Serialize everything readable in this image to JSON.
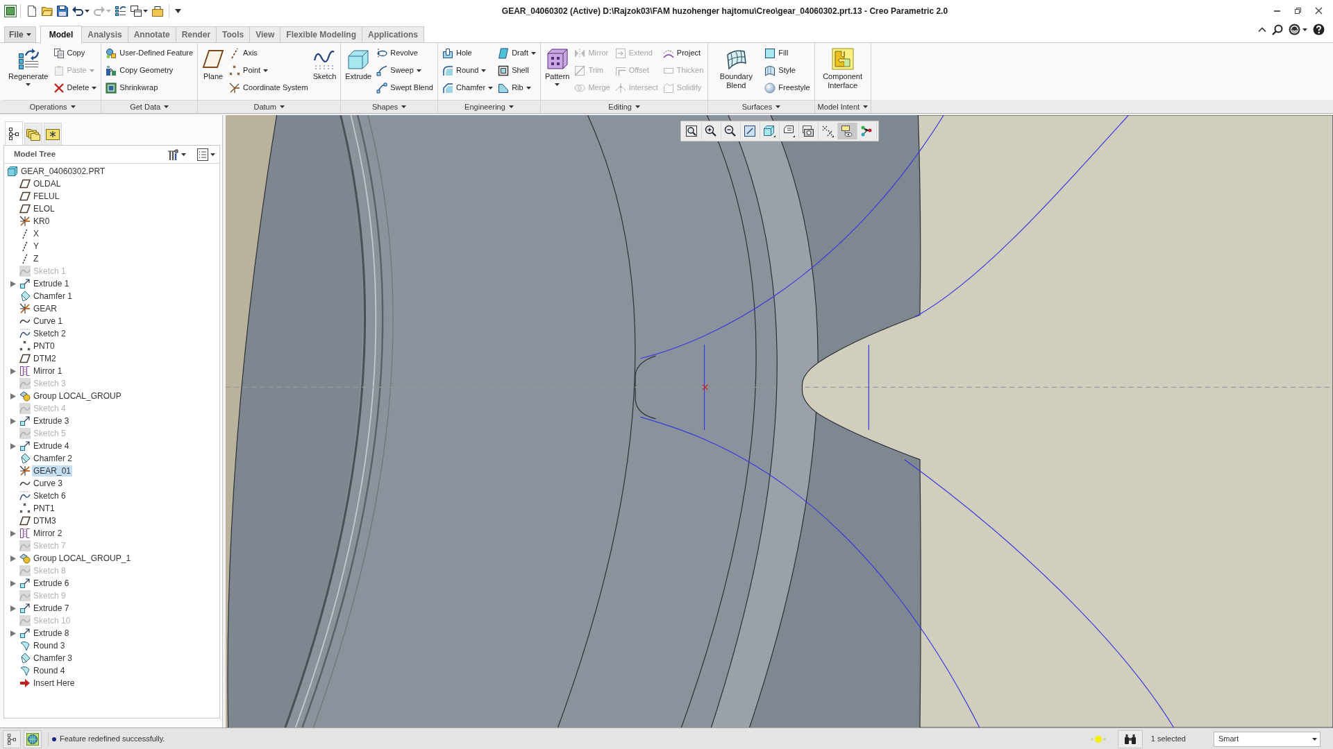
{
  "window": {
    "title": "GEAR_04060302 (Active) D:\\Rajzok03\\FAM huzohenger hajtomu\\Creo\\gear_04060302.prt.13 - Creo Parametric 2.0"
  },
  "quick_access_toolbar": [
    {
      "disabled": false,
      "dropdown": false
    },
    {
      "disabled": false,
      "dropdown": false
    },
    {
      "disabled": false,
      "dropdown": false
    },
    {
      "disabled": false,
      "dropdown": true
    },
    {
      "disabled": true,
      "dropdown": true
    },
    {
      "disabled": false,
      "dropdown": false
    },
    {
      "disabled": false,
      "dropdown": true
    },
    {
      "disabled": false,
      "dropdown": false
    }
  ],
  "ribbon_tabs": [
    {
      "label": "File",
      "kind": "menu",
      "selected": false
    },
    {
      "label": "Model",
      "kind": "tab",
      "selected": true
    },
    {
      "label": "Analysis",
      "kind": "tab",
      "selected": false
    },
    {
      "label": "Annotate",
      "kind": "tab",
      "selected": false
    },
    {
      "label": "Render",
      "kind": "tab",
      "selected": false
    },
    {
      "label": "Tools",
      "kind": "tab",
      "selected": false
    },
    {
      "label": "View",
      "kind": "tab",
      "selected": false
    },
    {
      "label": "Flexible Modeling",
      "kind": "tab",
      "selected": false
    },
    {
      "label": "Applications",
      "kind": "tab",
      "selected": false
    }
  ],
  "ribbon_groups": [
    {
      "label": "Operations",
      "columns": [
        {
          "items": [
            {
              "label": "Regenerate",
              "kind": "large",
              "disabled": false,
              "dropdown": true
            }
          ]
        },
        {
          "items": [
            {
              "label": "Copy",
              "kind": "small",
              "disabled": false,
              "dropdown": false
            },
            {
              "label": "Paste",
              "kind": "small",
              "disabled": true,
              "dropdown": true
            },
            {
              "label": "Delete",
              "kind": "small",
              "disabled": false,
              "dropdown": true
            }
          ]
        }
      ]
    },
    {
      "label": "Get Data",
      "columns": [
        {
          "items": [
            {
              "label": "User-Defined Feature",
              "kind": "small",
              "disabled": false,
              "dropdown": false
            },
            {
              "label": "Copy Geometry",
              "kind": "small",
              "disabled": false,
              "dropdown": false
            },
            {
              "label": "Shrinkwrap",
              "kind": "small",
              "disabled": false,
              "dropdown": false
            }
          ]
        }
      ]
    },
    {
      "label": "Datum",
      "columns": [
        {
          "items": [
            {
              "label": "Plane",
              "kind": "large",
              "disabled": false,
              "dropdown": false
            }
          ]
        },
        {
          "items": [
            {
              "label": "Axis",
              "kind": "small",
              "disabled": false,
              "dropdown": false
            },
            {
              "label": "Point",
              "kind": "small",
              "disabled": false,
              "dropdown": true
            },
            {
              "label": "Coordinate System",
              "kind": "small",
              "disabled": false,
              "dropdown": false
            }
          ]
        },
        {
          "items": [
            {
              "label": "Sketch",
              "kind": "large",
              "disabled": false,
              "dropdown": false
            }
          ]
        }
      ]
    },
    {
      "label": "Shapes",
      "columns": [
        {
          "items": [
            {
              "label": "Extrude",
              "kind": "large",
              "disabled": false,
              "dropdown": false
            }
          ]
        },
        {
          "items": [
            {
              "label": "Revolve",
              "kind": "small",
              "disabled": false,
              "dropdown": false
            },
            {
              "label": "Sweep",
              "kind": "small",
              "disabled": false,
              "dropdown": true
            },
            {
              "label": "Swept Blend",
              "kind": "small",
              "disabled": false,
              "dropdown": false
            }
          ]
        }
      ]
    },
    {
      "label": "Engineering",
      "columns": [
        {
          "items": [
            {
              "label": "Hole",
              "kind": "small",
              "disabled": false,
              "dropdown": false
            },
            {
              "label": "Round",
              "kind": "small",
              "disabled": false,
              "dropdown": true
            },
            {
              "label": "Chamfer",
              "kind": "small",
              "disabled": false,
              "dropdown": true
            }
          ]
        },
        {
          "items": [
            {
              "label": "Draft",
              "kind": "small",
              "disabled": false,
              "dropdown": true
            },
            {
              "label": "Shell",
              "kind": "small",
              "disabled": false,
              "dropdown": false
            },
            {
              "label": "Rib",
              "kind": "small",
              "disabled": false,
              "dropdown": true
            }
          ]
        }
      ]
    },
    {
      "label": "Editing",
      "columns": [
        {
          "items": [
            {
              "label": "Pattern",
              "kind": "large",
              "disabled": false,
              "dropdown": true
            }
          ]
        },
        {
          "items": [
            {
              "label": "Mirror",
              "kind": "small",
              "disabled": true,
              "dropdown": false
            },
            {
              "label": "Trim",
              "kind": "small",
              "disabled": true,
              "dropdown": false
            },
            {
              "label": "Merge",
              "kind": "small",
              "disabled": true,
              "dropdown": false
            }
          ]
        },
        {
          "items": [
            {
              "label": "Extend",
              "kind": "small",
              "disabled": true,
              "dropdown": false
            },
            {
              "label": "Offset",
              "kind": "small",
              "disabled": true,
              "dropdown": false
            },
            {
              "label": "Intersect",
              "kind": "small",
              "disabled": true,
              "dropdown": false
            }
          ]
        },
        {
          "items": [
            {
              "label": "Project",
              "kind": "small",
              "disabled": false,
              "dropdown": false
            },
            {
              "label": "Thicken",
              "kind": "small",
              "disabled": true,
              "dropdown": false
            },
            {
              "label": "Solidify",
              "kind": "small",
              "disabled": true,
              "dropdown": false
            }
          ]
        }
      ]
    },
    {
      "label": "Surfaces",
      "columns": [
        {
          "items": [
            {
              "label": "Boundary Blend",
              "kind": "large",
              "disabled": false,
              "dropdown": false
            }
          ]
        },
        {
          "items": [
            {
              "label": "Fill",
              "kind": "small",
              "disabled": false,
              "dropdown": false
            },
            {
              "label": "Style",
              "kind": "small",
              "disabled": false,
              "dropdown": false
            },
            {
              "label": "Freestyle",
              "kind": "small",
              "disabled": false,
              "dropdown": false
            }
          ]
        }
      ]
    },
    {
      "label": "Model Intent",
      "columns": [
        {
          "items": [
            {
              "label": "Component Interface",
              "kind": "large",
              "disabled": false,
              "dropdown": false
            }
          ]
        }
      ]
    }
  ],
  "navigator_tabs": [
    {
      "selected": true
    },
    {
      "selected": false
    },
    {
      "selected": false
    }
  ],
  "model_tree": {
    "title": "Model Tree",
    "root": {
      "label": "GEAR_04060302.PRT",
      "kind": "part",
      "children": [
        {
          "label": "OLDAL",
          "kind": "plane",
          "collapsed": false,
          "greyed": false,
          "selected": false
        },
        {
          "label": "FELUL",
          "kind": "plane",
          "collapsed": false,
          "greyed": false,
          "selected": false
        },
        {
          "label": "ELOL",
          "kind": "plane",
          "collapsed": false,
          "greyed": false,
          "selected": false
        },
        {
          "label": "KR0",
          "kind": "csys",
          "collapsed": false,
          "greyed": false,
          "selected": false
        },
        {
          "label": "X",
          "kind": "axis",
          "collapsed": false,
          "greyed": false,
          "selected": false
        },
        {
          "label": "Y",
          "kind": "axis",
          "collapsed": false,
          "greyed": false,
          "selected": false
        },
        {
          "label": "Z",
          "kind": "axis",
          "collapsed": false,
          "greyed": false,
          "selected": false
        },
        {
          "label": "Sketch 1",
          "kind": "sketch",
          "collapsed": false,
          "greyed": true,
          "selected": false
        },
        {
          "label": "Extrude 1",
          "kind": "extrude",
          "collapsed": true,
          "greyed": false,
          "selected": false
        },
        {
          "label": "Chamfer 1",
          "kind": "chamfer",
          "collapsed": false,
          "greyed": false,
          "selected": false
        },
        {
          "label": "GEAR",
          "kind": "csys",
          "collapsed": false,
          "greyed": false,
          "selected": false
        },
        {
          "label": "Curve 1",
          "kind": "curve",
          "collapsed": false,
          "greyed": false,
          "selected": false
        },
        {
          "label": "Sketch 2",
          "kind": "sketch",
          "collapsed": false,
          "greyed": false,
          "selected": false
        },
        {
          "label": "PNT0",
          "kind": "point",
          "collapsed": false,
          "greyed": false,
          "selected": false
        },
        {
          "label": "DTM2",
          "kind": "plane",
          "collapsed": false,
          "greyed": false,
          "selected": false
        },
        {
          "label": "Mirror 1",
          "kind": "mirror",
          "collapsed": true,
          "greyed": false,
          "selected": false
        },
        {
          "label": "Sketch 3",
          "kind": "sketch",
          "collapsed": false,
          "greyed": true,
          "selected": false
        },
        {
          "label": "Group LOCAL_GROUP",
          "kind": "group",
          "collapsed": true,
          "greyed": false,
          "selected": false
        },
        {
          "label": "Sketch 4",
          "kind": "sketch",
          "collapsed": false,
          "greyed": true,
          "selected": false
        },
        {
          "label": "Extrude 3",
          "kind": "extrude",
          "collapsed": true,
          "greyed": false,
          "selected": false
        },
        {
          "label": "Sketch 5",
          "kind": "sketch",
          "collapsed": false,
          "greyed": true,
          "selected": false
        },
        {
          "label": "Extrude 4",
          "kind": "extrude",
          "collapsed": true,
          "greyed": false,
          "selected": false
        },
        {
          "label": "Chamfer 2",
          "kind": "chamfer",
          "collapsed": false,
          "greyed": false,
          "selected": false
        },
        {
          "label": "GEAR_01",
          "kind": "csys",
          "collapsed": false,
          "greyed": false,
          "selected": true
        },
        {
          "label": "Curve 3",
          "kind": "curve",
          "collapsed": false,
          "greyed": false,
          "selected": false
        },
        {
          "label": "Sketch 6",
          "kind": "sketch",
          "collapsed": false,
          "greyed": false,
          "selected": false
        },
        {
          "label": "PNT1",
          "kind": "point",
          "collapsed": false,
          "greyed": false,
          "selected": false
        },
        {
          "label": "DTM3",
          "kind": "plane",
          "collapsed": false,
          "greyed": false,
          "selected": false
        },
        {
          "label": "Mirror 2",
          "kind": "mirror",
          "collapsed": true,
          "greyed": false,
          "selected": false
        },
        {
          "label": "Sketch 7",
          "kind": "sketch",
          "collapsed": false,
          "greyed": true,
          "selected": false
        },
        {
          "label": "Group LOCAL_GROUP_1",
          "kind": "group",
          "collapsed": true,
          "greyed": false,
          "selected": false
        },
        {
          "label": "Sketch 8",
          "kind": "sketch",
          "collapsed": false,
          "greyed": true,
          "selected": false
        },
        {
          "label": "Extrude 6",
          "kind": "extrude",
          "collapsed": true,
          "greyed": false,
          "selected": false
        },
        {
          "label": "Sketch 9",
          "kind": "sketch",
          "collapsed": false,
          "greyed": true,
          "selected": false
        },
        {
          "label": "Extrude 7",
          "kind": "extrude",
          "collapsed": true,
          "greyed": false,
          "selected": false
        },
        {
          "label": "Sketch 10",
          "kind": "sketch",
          "collapsed": false,
          "greyed": true,
          "selected": false
        },
        {
          "label": "Extrude 8",
          "kind": "extrude",
          "collapsed": true,
          "greyed": false,
          "selected": false
        },
        {
          "label": "Round 3",
          "kind": "round",
          "collapsed": false,
          "greyed": false,
          "selected": false
        },
        {
          "label": "Chamfer 3",
          "kind": "chamfer",
          "collapsed": false,
          "greyed": false,
          "selected": false
        },
        {
          "label": "Round 4",
          "kind": "round",
          "collapsed": false,
          "greyed": false,
          "selected": false
        },
        {
          "label": "Insert Here",
          "kind": "insert",
          "collapsed": false,
          "greyed": false,
          "selected": false
        }
      ]
    }
  },
  "view_toolbar": [
    {
      "pressed": false,
      "dropdown": false
    },
    {
      "pressed": false,
      "dropdown": false
    },
    {
      "pressed": false,
      "dropdown": false
    },
    {
      "pressed": false,
      "dropdown": false
    },
    {
      "pressed": false,
      "dropdown": true
    },
    {
      "pressed": false,
      "dropdown": true
    },
    {
      "pressed": false,
      "dropdown": false
    },
    {
      "pressed": false,
      "dropdown": true
    },
    {
      "pressed": true,
      "dropdown": false
    },
    {
      "pressed": false,
      "dropdown": false
    }
  ],
  "status_bar": {
    "message": "Feature redefined successfully.",
    "selection": "1 selected",
    "filter": "Smart"
  }
}
